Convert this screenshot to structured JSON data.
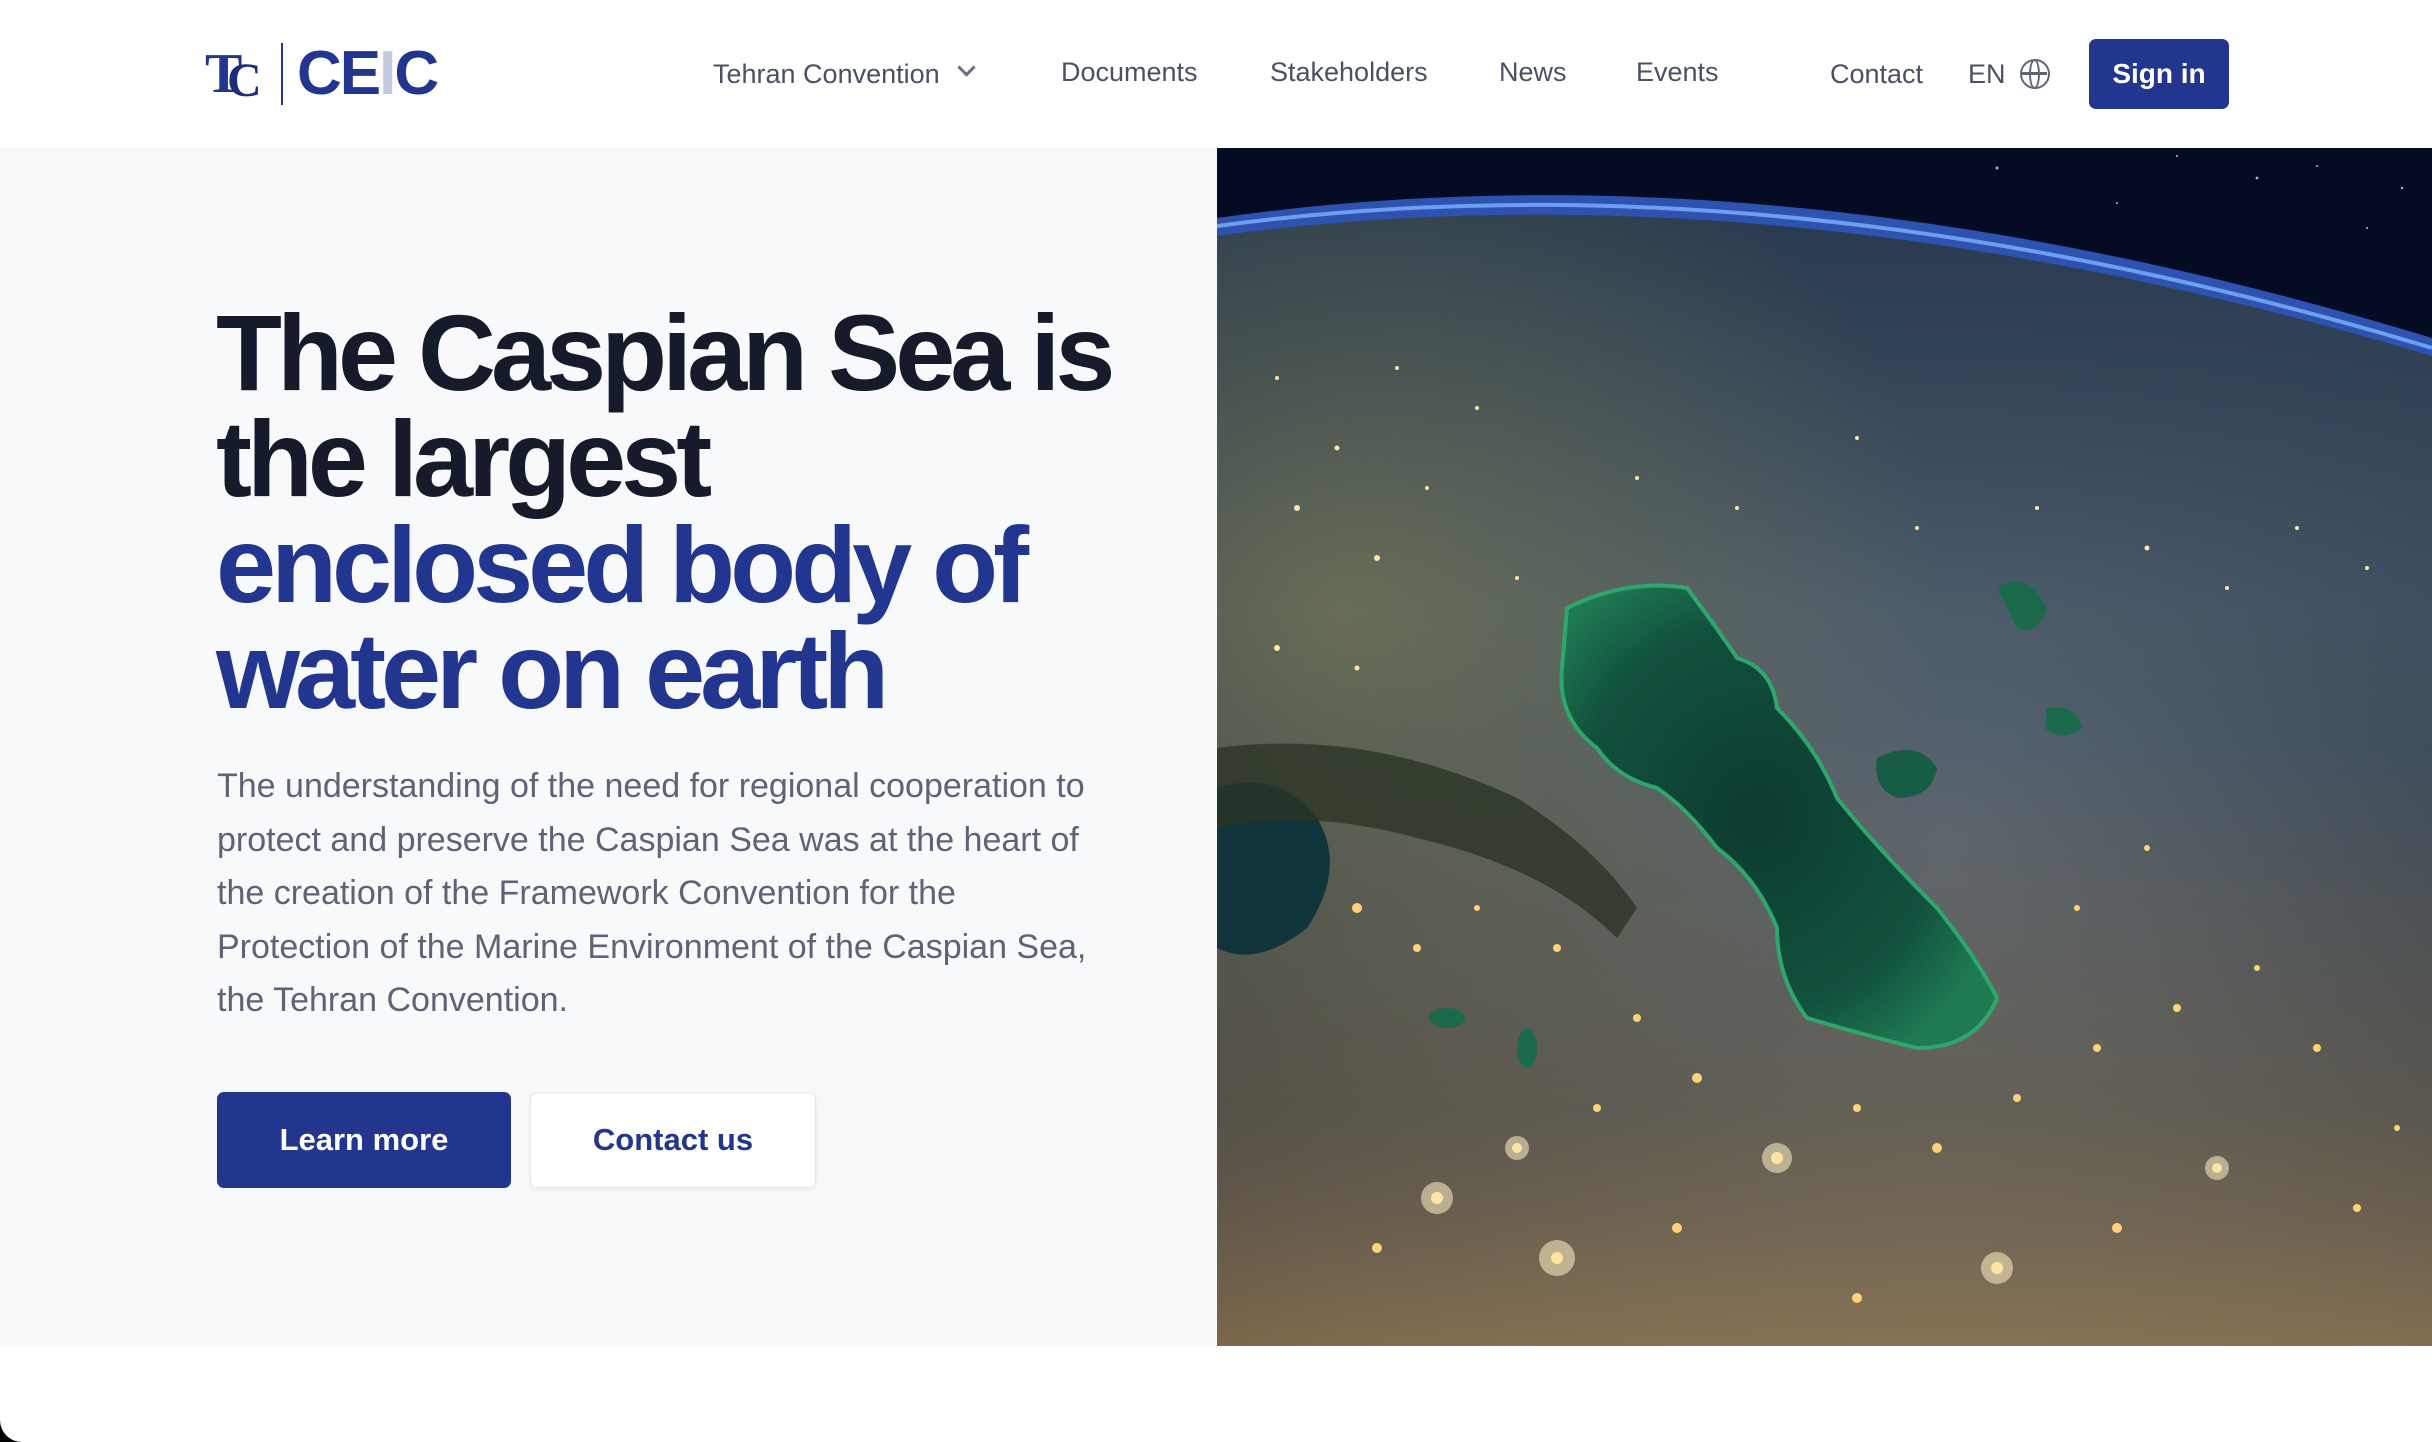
{
  "header": {
    "logo": {
      "mark": "TC",
      "name": "CEIC"
    },
    "nav": {
      "tehran_convention": "Tehran Convention",
      "documents": "Documents",
      "stakeholders": "Stakeholders",
      "news": "News",
      "events": "Events",
      "contact": "Contact"
    },
    "language": "EN",
    "sign_in": "Sign in"
  },
  "hero": {
    "headline_dark_1": "The Caspian Sea is",
    "headline_dark_2": "the largest",
    "headline_blue_1": "enclosed body of",
    "headline_blue_2": "water on earth",
    "lead": "The understanding of the need for regional cooperation to protect and preserve the Caspian Sea was at the heart of the creation of the Framework Convention for the Protection of the Marine Environment of the Caspian Sea, the Tehran Convention.",
    "primary_button": "Learn more",
    "secondary_button": "Contact us"
  },
  "colors": {
    "brand": "#22358f",
    "heading": "#161b2c",
    "body_text": "#5d6474",
    "hero_background": "#f8f9fb"
  },
  "icons": [
    "chevron-down-icon",
    "globe-icon"
  ]
}
